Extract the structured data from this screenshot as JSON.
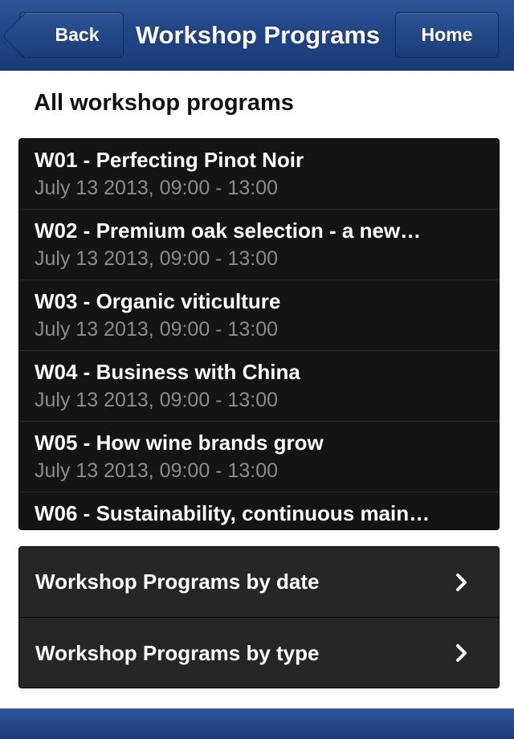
{
  "header": {
    "back_label": "Back",
    "title": "Workshop Programs",
    "home_label": "Home"
  },
  "section_title": "All workshop programs",
  "programs": [
    {
      "name": "W01 - Perfecting Pinot Noir",
      "time": "July 13 2013, 09:00 - 13:00"
    },
    {
      "name": "W02 - Premium oak selection - a new…",
      "time": "July 13 2013, 09:00 - 13:00"
    },
    {
      "name": "W03 - Organic viticulture",
      "time": "July 13 2013, 09:00 - 13:00"
    },
    {
      "name": "W04 - Business with China",
      "time": "July 13 2013, 09:00 - 13:00"
    },
    {
      "name": "W05 - How wine brands grow",
      "time": "July 13 2013, 09:00 - 13:00"
    },
    {
      "name": "W06 - Sustainability, continuous main…",
      "time": ""
    }
  ],
  "filters": [
    {
      "label": "Workshop Programs by date",
      "icon": "chevron-right-icon"
    },
    {
      "label": "Workshop Programs by type",
      "icon": "chevron-right-icon"
    }
  ],
  "colors": {
    "navbar": "#1f4483",
    "list_background": "#141414",
    "filter_background": "#262626",
    "subtitle_text": "#8c8c8c"
  }
}
